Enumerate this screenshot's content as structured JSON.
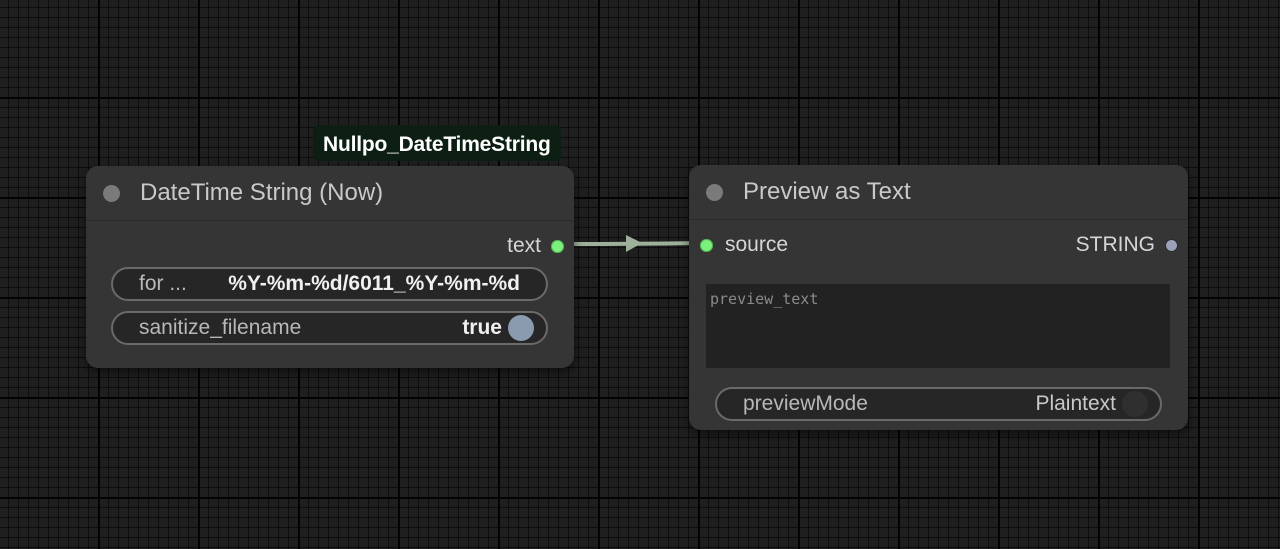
{
  "badge": {
    "label": "Nullpo_DateTimeString"
  },
  "node_datetime": {
    "title": "DateTime String (Now)",
    "output_label": "text",
    "format_widget": {
      "label": "for ...",
      "value": "%Y-%m-%d/6011_%Y-%m-%d"
    },
    "sanitize_widget": {
      "label": "sanitize_filename",
      "value": "true"
    }
  },
  "node_preview": {
    "title": "Preview as Text",
    "input_label": "source",
    "output_label": "STRING",
    "preview_text": {
      "placeholder": "preview_text",
      "value": ""
    },
    "mode_widget": {
      "label": "previewMode",
      "value": "Plaintext"
    }
  },
  "colors": {
    "slot_active": "#7cf07c",
    "link": "#9db09a",
    "badge_bg": "#0c1f12",
    "node_bg": "#353535",
    "toggle_on_knob": "#8a9bb0",
    "toggle_off_knob": "#2f2f2f"
  },
  "icons": {
    "title_dot": "circle-dot-icon",
    "slot_green": "circle-slot-icon",
    "toggle_knob": "toggle-knob-icon",
    "link_arrow": "arrow-right-icon"
  }
}
